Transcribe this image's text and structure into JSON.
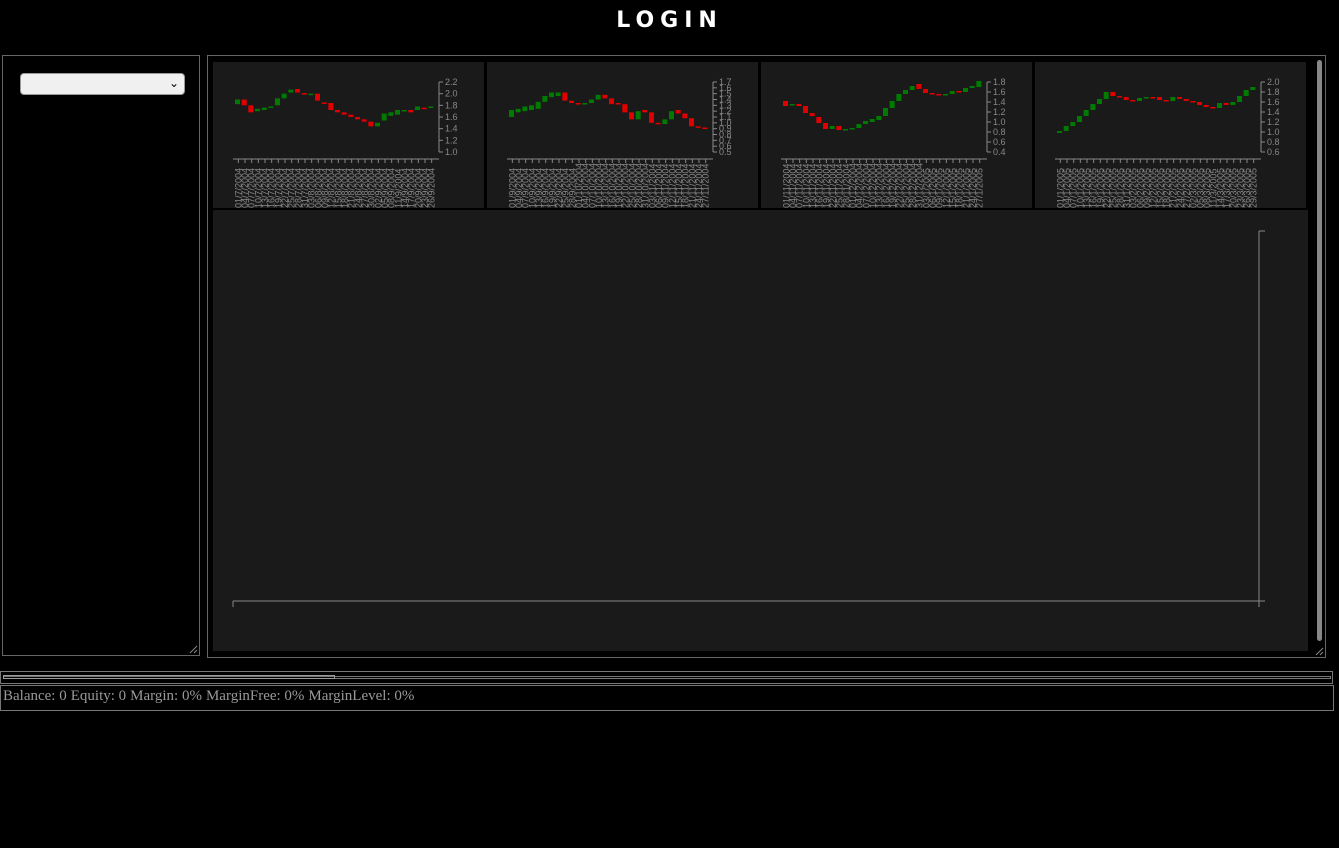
{
  "header": {
    "title": "LOGIN"
  },
  "sidebar": {
    "symbol_select": {
      "value": ""
    }
  },
  "status": {
    "balance": "Balance: 0",
    "equity": "Equity: 0",
    "margin": "Margin: 0%",
    "margin_free": "MarginFree: 0%",
    "margin_level": "MarginLevel: 0%"
  },
  "colors": {
    "up": "#007a00",
    "down": "#e00000",
    "axis": "#888888",
    "panel": "#1a1a1a"
  },
  "chart_data": [
    {
      "type": "candlestick",
      "ylim": [
        1.0,
        2.2
      ],
      "ticks": [
        "1.0",
        "1.2",
        "1.4",
        "1.6",
        "1.8",
        "2.0",
        "2.2"
      ],
      "dates": [
        "01/7/2004",
        "04/7/2004",
        "07/7/2004",
        "10/7/2004",
        "13/7/2004",
        "16/7/2004",
        "19/7/2004",
        "22/7/2004",
        "25/7/2004",
        "28/7/2004",
        "31/7/2004",
        "03/8/2004",
        "06/8/2004",
        "09/8/2004",
        "12/8/2004",
        "15/8/2004",
        "18/8/2004",
        "21/8/2004",
        "24/8/2004",
        "27/8/2004",
        "30/8/2004",
        "02/9/2004",
        "05/9/2004",
        "08/9/2004",
        "11/9/2004",
        "14/9/2004",
        "17/9/2004",
        "20/9/2004",
        "23/9/2004",
        "26/9/2004"
      ],
      "candles": [
        [
          1.82,
          1.9
        ],
        [
          1.9,
          1.8
        ],
        [
          1.8,
          1.68
        ],
        [
          1.7,
          1.74
        ],
        [
          1.72,
          1.76
        ],
        [
          1.76,
          1.78
        ],
        [
          1.8,
          1.92
        ],
        [
          1.92,
          2.0
        ],
        [
          2.02,
          2.07
        ],
        [
          2.08,
          2.02
        ],
        [
          2.01,
          2.0
        ],
        [
          2.0,
          2.0
        ],
        [
          2.0,
          1.88
        ],
        [
          1.85,
          1.84
        ],
        [
          1.84,
          1.72
        ],
        [
          1.72,
          1.68
        ],
        [
          1.68,
          1.64
        ],
        [
          1.64,
          1.6
        ],
        [
          1.6,
          1.56
        ],
        [
          1.56,
          1.52
        ],
        [
          1.52,
          1.44
        ],
        [
          1.44,
          1.5
        ],
        [
          1.54,
          1.66
        ],
        [
          1.62,
          1.68
        ],
        [
          1.64,
          1.72
        ],
        [
          1.7,
          1.72
        ],
        [
          1.72,
          1.68
        ],
        [
          1.72,
          1.78
        ],
        [
          1.76,
          1.74
        ],
        [
          1.76,
          1.78
        ]
      ]
    },
    {
      "type": "candlestick",
      "ylim": [
        0.5,
        1.7
      ],
      "ticks": [
        "0.5",
        "0.6",
        "0.7",
        "0.8",
        "0.9",
        "1.0",
        "1.1",
        "1.2",
        "1.3",
        "1.4",
        "1.5",
        "1.6",
        "1.7"
      ],
      "dates": [
        "01/9/2004",
        "04/9/2004",
        "07/9/2004",
        "10/9/2004",
        "13/9/2004",
        "16/9/2004",
        "19/9/2004",
        "22/9/2004",
        "25/9/2004",
        "28/9/2004",
        "01/10/2004",
        "04/10/2004",
        "07/10/2004",
        "10/10/2004",
        "13/10/2004",
        "16/10/2004",
        "19/10/2004",
        "22/10/2004",
        "25/10/2004",
        "28/10/2004",
        "31/10/2004",
        "03/11/2004",
        "06/11/2004",
        "09/11/2004",
        "12/11/2004",
        "15/11/2004",
        "18/11/2004",
        "21/11/2004",
        "24/11/2004",
        "27/11/2004"
      ],
      "candles": [
        [
          1.1,
          1.22
        ],
        [
          1.18,
          1.24
        ],
        [
          1.2,
          1.28
        ],
        [
          1.22,
          1.3
        ],
        [
          1.24,
          1.36
        ],
        [
          1.36,
          1.46
        ],
        [
          1.44,
          1.52
        ],
        [
          1.46,
          1.52
        ],
        [
          1.52,
          1.38
        ],
        [
          1.38,
          1.34
        ],
        [
          1.34,
          1.32
        ],
        [
          1.32,
          1.34
        ],
        [
          1.34,
          1.4
        ],
        [
          1.4,
          1.48
        ],
        [
          1.48,
          1.42
        ],
        [
          1.42,
          1.32
        ],
        [
          1.34,
          1.32
        ],
        [
          1.32,
          1.18
        ],
        [
          1.18,
          1.06
        ],
        [
          1.06,
          1.2
        ],
        [
          1.22,
          1.18
        ],
        [
          1.18,
          1.0
        ],
        [
          1.0,
          0.98
        ],
        [
          0.98,
          1.06
        ],
        [
          1.06,
          1.2
        ],
        [
          1.22,
          1.16
        ],
        [
          1.16,
          1.08
        ],
        [
          1.08,
          0.94
        ],
        [
          0.94,
          0.92
        ],
        [
          0.92,
          0.9
        ]
      ]
    },
    {
      "type": "candlestick",
      "ylim": [
        0.4,
        1.8
      ],
      "ticks": [
        "0.4",
        "0.6",
        "0.8",
        "1.0",
        "1.2",
        "1.4",
        "1.6",
        "1.8"
      ],
      "dates": [
        "01/11/2004",
        "04/11/2004",
        "07/11/2004",
        "10/11/2004",
        "13/11/2004",
        "16/11/2004",
        "19/11/2004",
        "22/11/2004",
        "25/11/2004",
        "28/11/2004",
        "01/12/2004",
        "04/12/2004",
        "07/12/2004",
        "10/12/2004",
        "13/12/2004",
        "16/12/2004",
        "19/12/2004",
        "22/12/2004",
        "25/12/2004",
        "28/12/2004",
        "31/12/2004",
        "03/1/2005",
        "06/1/2005",
        "09/1/2005",
        "12/1/2005",
        "15/1/2005",
        "18/1/2005",
        "21/1/2005",
        "24/1/2005",
        "27/1/2005"
      ],
      "candles": [
        [
          1.42,
          1.32
        ],
        [
          1.34,
          1.36
        ],
        [
          1.36,
          1.32
        ],
        [
          1.32,
          1.18
        ],
        [
          1.18,
          1.12
        ],
        [
          1.1,
          0.98
        ],
        [
          0.98,
          0.86
        ],
        [
          0.86,
          0.92
        ],
        [
          0.92,
          0.84
        ],
        [
          0.84,
          0.86
        ],
        [
          0.86,
          0.88
        ],
        [
          0.88,
          0.96
        ],
        [
          0.96,
          1.02
        ],
        [
          1.0,
          1.06
        ],
        [
          1.04,
          1.12
        ],
        [
          1.12,
          1.28
        ],
        [
          1.28,
          1.42
        ],
        [
          1.42,
          1.56
        ],
        [
          1.56,
          1.64
        ],
        [
          1.64,
          1.72
        ],
        [
          1.76,
          1.66
        ],
        [
          1.66,
          1.58
        ],
        [
          1.58,
          1.56
        ],
        [
          1.56,
          1.54
        ],
        [
          1.54,
          1.56
        ],
        [
          1.56,
          1.62
        ],
        [
          1.62,
          1.6
        ],
        [
          1.6,
          1.68
        ],
        [
          1.68,
          1.72
        ],
        [
          1.7,
          1.82
        ]
      ]
    },
    {
      "type": "candlestick",
      "ylim": [
        0.6,
        2.0
      ],
      "ticks": [
        "0.6",
        "0.8",
        "1.0",
        "1.2",
        "1.4",
        "1.6",
        "1.8",
        "2.0"
      ],
      "dates": [
        "01/1/2005",
        "04/1/2005",
        "07/1/2005",
        "10/1/2005",
        "13/1/2005",
        "16/1/2005",
        "19/1/2005",
        "22/1/2005",
        "25/1/2005",
        "28/1/2005",
        "31/1/2005",
        "03/2/2005",
        "06/2/2005",
        "09/2/2005",
        "12/2/2005",
        "15/2/2005",
        "18/2/2005",
        "21/2/2005",
        "24/2/2005",
        "27/2/2005",
        "02/3/2005",
        "05/3/2005",
        "08/3/2005",
        "11/3/2005",
        "14/3/2005",
        "17/3/2005",
        "20/3/2005",
        "23/3/2005",
        "26/3/2005",
        "29/3/2005"
      ],
      "candles": [
        [
          0.98,
          1.02
        ],
        [
          1.02,
          1.12
        ],
        [
          1.12,
          1.2
        ],
        [
          1.2,
          1.32
        ],
        [
          1.32,
          1.44
        ],
        [
          1.44,
          1.56
        ],
        [
          1.56,
          1.66
        ],
        [
          1.66,
          1.8
        ],
        [
          1.8,
          1.72
        ],
        [
          1.72,
          1.7
        ],
        [
          1.7,
          1.64
        ],
        [
          1.64,
          1.62
        ],
        [
          1.62,
          1.68
        ],
        [
          1.68,
          1.7
        ],
        [
          1.7,
          1.68
        ],
        [
          1.7,
          1.64
        ],
        [
          1.64,
          1.62
        ],
        [
          1.62,
          1.7
        ],
        [
          1.7,
          1.66
        ],
        [
          1.66,
          1.62
        ],
        [
          1.62,
          1.6
        ],
        [
          1.6,
          1.54
        ],
        [
          1.54,
          1.5
        ],
        [
          1.5,
          1.48
        ],
        [
          1.48,
          1.58
        ],
        [
          1.58,
          1.54
        ],
        [
          1.54,
          1.6
        ],
        [
          1.6,
          1.72
        ],
        [
          1.72,
          1.84
        ],
        [
          1.84,
          1.9
        ]
      ]
    }
  ]
}
